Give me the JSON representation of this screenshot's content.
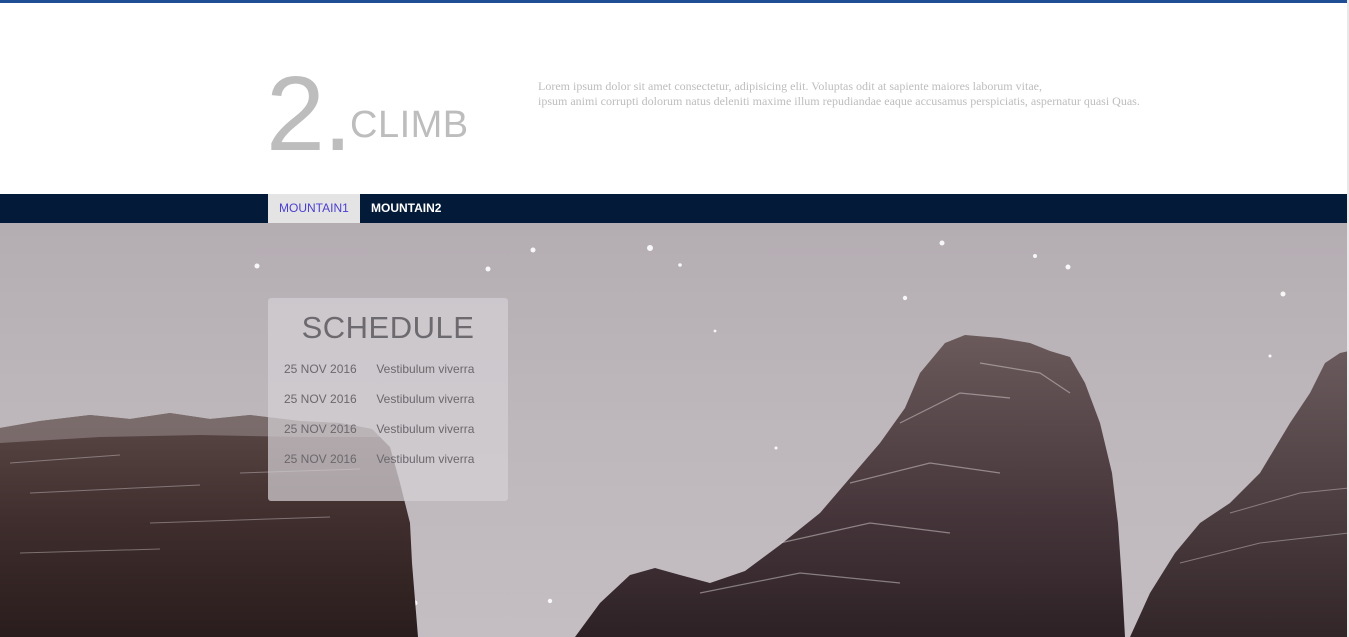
{
  "header": {
    "step_number": "2.",
    "step_title": "CLIMB",
    "intro_line_1": "Lorem ipsum dolor sit amet consectetur, adipisicing elit. Voluptas odit at sapiente maiores laborum vitae,",
    "intro_line_2": "ipsum animi corrupti dolorum natus deleniti maxime illum repudiandae eaque accusamus perspiciatis, aspernatur quasi Quas."
  },
  "nav": {
    "tabs": [
      {
        "label": "MOUNTAIN1",
        "active": true
      },
      {
        "label": "MOUNTAIN2",
        "active": false
      }
    ]
  },
  "schedule": {
    "title": "SCHEDULE",
    "rows": [
      {
        "date": "25 NOV 2016",
        "event": "Vestibulum viverra"
      },
      {
        "date": "25 NOV 2016",
        "event": "Vestibulum viverra"
      },
      {
        "date": "25 NOV 2016",
        "event": "Vestibulum viverra"
      },
      {
        "date": "25 NOV 2016",
        "event": "Vestibulum viverra"
      }
    ]
  },
  "colors": {
    "top_line": "#1f4e94",
    "nav_background": "#031a39",
    "active_tab_text": "#4b3fd1",
    "muted_heading": "#bdbdbd"
  }
}
